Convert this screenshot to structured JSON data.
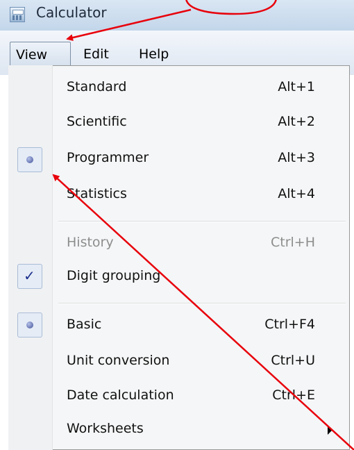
{
  "window": {
    "title": "Calculator"
  },
  "menubar": {
    "items": [
      "View",
      "Edit",
      "Help"
    ],
    "active": "View"
  },
  "view_menu": {
    "items": [
      {
        "label": "Standard",
        "shortcut": "Alt+1"
      },
      {
        "label": "Scientific",
        "shortcut": "Alt+2"
      },
      {
        "label": "Programmer",
        "shortcut": "Alt+3",
        "selected": "radio"
      },
      {
        "label": "Statistics",
        "shortcut": "Alt+4"
      },
      {
        "label": "History",
        "shortcut": "Ctrl+H",
        "disabled": true
      },
      {
        "label": "Digit grouping",
        "shortcut": "",
        "selected": "check"
      },
      {
        "label": "Basic",
        "shortcut": "Ctrl+F4",
        "selected": "radio"
      },
      {
        "label": "Unit conversion",
        "shortcut": "Ctrl+U"
      },
      {
        "label": "Date calculation",
        "shortcut": "Ctrl+E"
      },
      {
        "label": "Worksheets",
        "shortcut": "",
        "submenu": true
      }
    ]
  },
  "colors": {
    "annotation": "#e8000b",
    "radio": "#3f4f96",
    "check": "#1a2f8c",
    "disabled_text": "#8d8d8d"
  },
  "icons": {
    "app": "calculator-app-icon",
    "radio": "radio-dot-icon",
    "check": "checkmark-icon",
    "submenu": "submenu-arrow-icon"
  }
}
